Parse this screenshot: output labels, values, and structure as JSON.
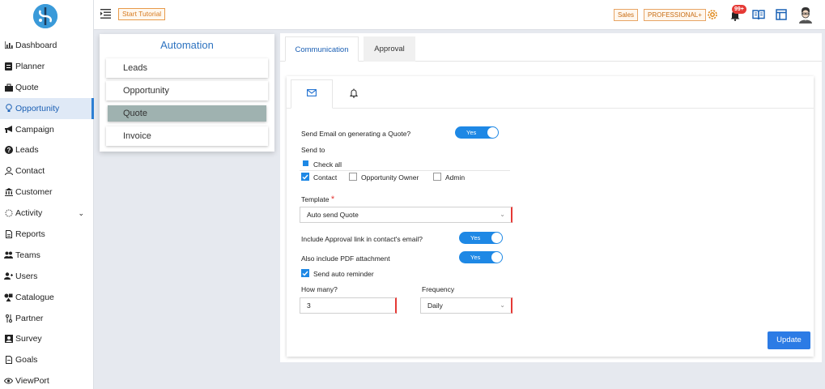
{
  "sidebar": {
    "items": [
      {
        "label": "Dashboard",
        "icon": "chart-icon"
      },
      {
        "label": "Planner",
        "icon": "planner-icon"
      },
      {
        "label": "Quote",
        "icon": "bag-icon"
      },
      {
        "label": "Opportunity",
        "icon": "bulb-icon"
      },
      {
        "label": "Campaign",
        "icon": "megaphone-icon"
      },
      {
        "label": "Leads",
        "icon": "question-icon"
      },
      {
        "label": "Contact",
        "icon": "person-icon"
      },
      {
        "label": "Customer",
        "icon": "bank-icon"
      },
      {
        "label": "Activity",
        "icon": "sun-icon"
      },
      {
        "label": "Reports",
        "icon": "doc-icon"
      },
      {
        "label": "Teams",
        "icon": "team-icon"
      },
      {
        "label": "Users",
        "icon": "user-add-icon"
      },
      {
        "label": "Catalogue",
        "icon": "shapes-icon"
      },
      {
        "label": "Partner",
        "icon": "partner-icon"
      },
      {
        "label": "Survey",
        "icon": "survey-icon"
      },
      {
        "label": "Goals",
        "icon": "goal-icon"
      },
      {
        "label": "ViewPort",
        "icon": "eye-icon"
      }
    ],
    "active": "Opportunity"
  },
  "topbar": {
    "tutorial_label": "Start Tutorial",
    "sales_tag": "Sales",
    "plan_tag": "PROFESSIONAL+",
    "notification_count": "99+"
  },
  "automation": {
    "title": "Automation",
    "items": [
      "Leads",
      "Opportunity",
      "Quote",
      "Invoice"
    ],
    "selected": "Quote"
  },
  "tabs": [
    "Communication",
    "Approval"
  ],
  "form": {
    "send_email_label": "Send Email on generating a Quote?",
    "send_email_toggle": "Yes",
    "send_to_label": "Send to",
    "check_all_label": "Check all",
    "recipients": [
      {
        "label": "Contact",
        "checked": true
      },
      {
        "label": "Opportunity Owner",
        "checked": false
      },
      {
        "label": "Admin",
        "checked": false
      }
    ],
    "template_label": "Template",
    "template_required": "*",
    "template_value": "Auto send Quote",
    "approval_link_label": "Include Approval link in contact's email?",
    "approval_link_toggle": "Yes",
    "pdf_label": "Also include PDF attachment",
    "pdf_toggle": "Yes",
    "reminder_label": "Send auto reminder",
    "how_many_label": "How many?",
    "how_many_value": "3",
    "frequency_label": "Frequency",
    "frequency_value": "Daily",
    "update_label": "Update"
  },
  "colors": {
    "accent": "#1e88e5",
    "tag_orange": "#c86d14",
    "selected_item": "#9fb2b0",
    "required": "#e53935"
  }
}
